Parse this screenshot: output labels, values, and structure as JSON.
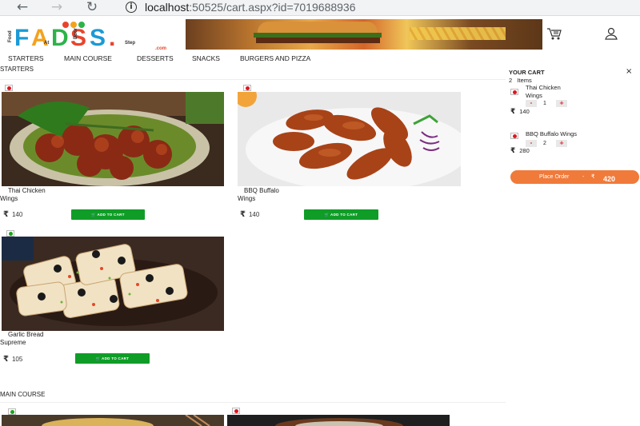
{
  "browser": {
    "url_host": "localhost",
    "url_path": ":50525/cart.aspx?id=7019688936",
    "back_icon": "arrow-left",
    "forward_icon": "arrow-right",
    "reload_icon": "reload",
    "info_icon": "i"
  },
  "header": {
    "logo_letters": "FADS",
    "logo_small": [
      "Food",
      "At",
      "Door",
      "Step",
      ".com"
    ],
    "cart_icon": "cart-icon",
    "user_icon": "user-icon"
  },
  "menu": {
    "items": [
      "STARTERS",
      "MAIN COURSE",
      "DESSERTS",
      "SNACKS",
      "BURGERS AND PIZZA"
    ]
  },
  "sections": {
    "starters": "STARTERS",
    "main_course": "MAIN COURSE"
  },
  "products": [
    {
      "name_line1": "Thai Chicken",
      "name_line2": "Wings",
      "price": "140",
      "add_label": "ADD TO CART",
      "type": "nonveg"
    },
    {
      "name_line1": "BBQ Buffalo",
      "name_line2": "Wings",
      "price": "140",
      "add_label": "ADD TO CART",
      "type": "nonveg"
    },
    {
      "name_line1": "Garlic Bread",
      "name_line2": "Supreme",
      "price": "105",
      "add_label": "ADD TO CART",
      "type": "veg"
    }
  ],
  "cart": {
    "title": "YOUR CART",
    "close": "×",
    "count": "2",
    "count_label": "Items",
    "items": [
      {
        "name_line1": "Thai Chicken",
        "name_line2": "Wings",
        "qty": "1",
        "minus": "-",
        "plus": "+",
        "price": "140"
      },
      {
        "name_line1": "BBQ Buffalo Wings",
        "name_line2": "",
        "qty": "2",
        "minus": "-",
        "plus": "+",
        "price": "280"
      }
    ],
    "place_order": "Place Order",
    "separator": "-",
    "currency": "₹",
    "total": "420"
  },
  "currency_symbol": "₹",
  "colors": {
    "add_button": "#0f9d27",
    "place_order": "#f07a3a",
    "nonveg": "#e0161f",
    "veg": "#1aa51a"
  }
}
